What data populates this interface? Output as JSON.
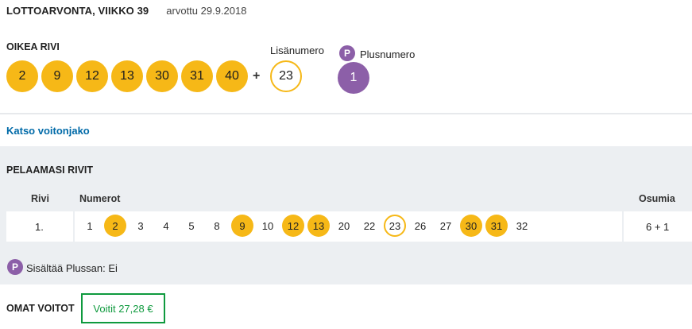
{
  "header": {
    "title": "LOTTOARVONTA, VIIKKO 39",
    "date": "arvottu 29.9.2018"
  },
  "correct_row": {
    "label": "OIKEA RIVI",
    "numbers": [
      "2",
      "9",
      "12",
      "13",
      "30",
      "31",
      "40"
    ],
    "plus_sign": "+",
    "extra_label": "Lisänumero",
    "extra_number": "23",
    "plus_icon": "P",
    "plus_label": "Plusnumero",
    "plus_number": "1"
  },
  "link": {
    "label": "Katso voitonjako"
  },
  "played": {
    "label": "PELAAMASI RIVIT",
    "columns": {
      "row": "Rivi",
      "numbers": "Numerot",
      "hits": "Osumia"
    },
    "rows": [
      {
        "index": "1.",
        "numbers": [
          "1",
          "2",
          "3",
          "4",
          "5",
          "8",
          "9",
          "10",
          "12",
          "13",
          "20",
          "22",
          "23",
          "26",
          "27",
          "30",
          "31",
          "32"
        ],
        "hits": "6 + 1"
      }
    ],
    "plus_icon": "P",
    "plus_info": "Sisältää Plussan: Ei"
  },
  "winnings": {
    "label": "OMAT VOITOT",
    "value": "Voitit 27,28 €"
  },
  "colors": {
    "ball": "#f6b817",
    "plus": "#8c5fa8",
    "link": "#006aa8",
    "win": "#0f9a3e"
  },
  "icons": {
    "plus_badge": "plus-p-icon"
  }
}
